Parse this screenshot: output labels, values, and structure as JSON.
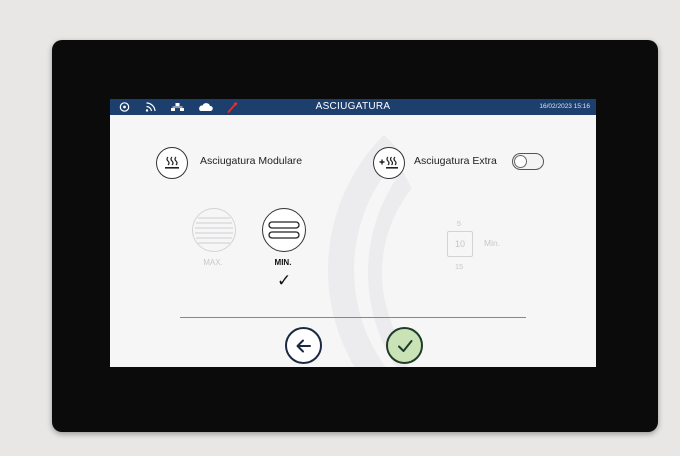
{
  "status_bar": {
    "title": "ASCIUGATURA",
    "datetime": "16/02/2023 15:16",
    "icons": [
      "settings-icon",
      "wifi-icon",
      "network-icon",
      "cloud-icon",
      "wrench-icon"
    ],
    "background": "#1c3f6e",
    "wrench_color": "#e0312b"
  },
  "modes": {
    "modular_label": "Asciugatura Modulare",
    "extra_label": "Asciugatura Extra",
    "extra_enabled": false
  },
  "levels": {
    "max_label": "MAX.",
    "min_label": "MIN.",
    "selected": "MIN.",
    "check": "✓"
  },
  "duration": {
    "prev": "5",
    "value": "10",
    "next": "15",
    "unit": "Min."
  },
  "footer": {
    "back_icon": "arrow-left-icon",
    "confirm_icon": "check-circle-icon",
    "confirm_color": "#c9e3b6"
  }
}
